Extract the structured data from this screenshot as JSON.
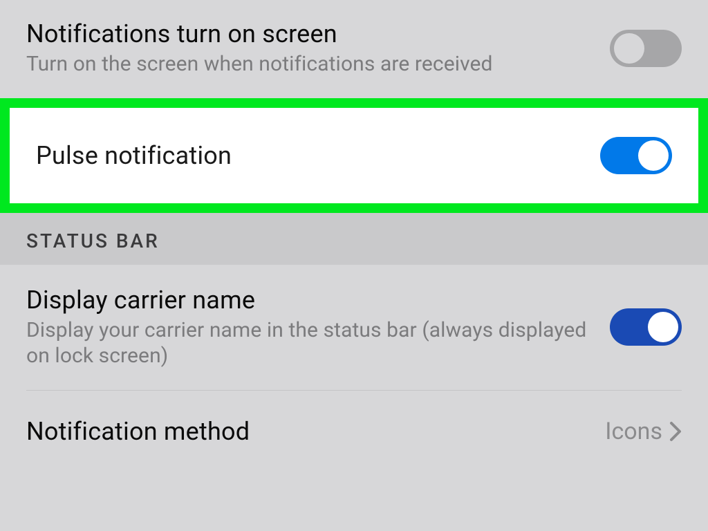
{
  "settings": {
    "notif_screen": {
      "title": "Notifications turn on screen",
      "subtitle": "Turn on the screen when notifications are received",
      "enabled": false
    },
    "pulse": {
      "title": "Pulse notification",
      "enabled": true
    },
    "section_status_bar": "STATUS BAR",
    "carrier": {
      "title": "Display carrier name",
      "subtitle": "Display your carrier name in the status bar (always displayed on lock screen)",
      "enabled": true
    },
    "notif_method": {
      "title": "Notification method",
      "value": "Icons"
    }
  }
}
